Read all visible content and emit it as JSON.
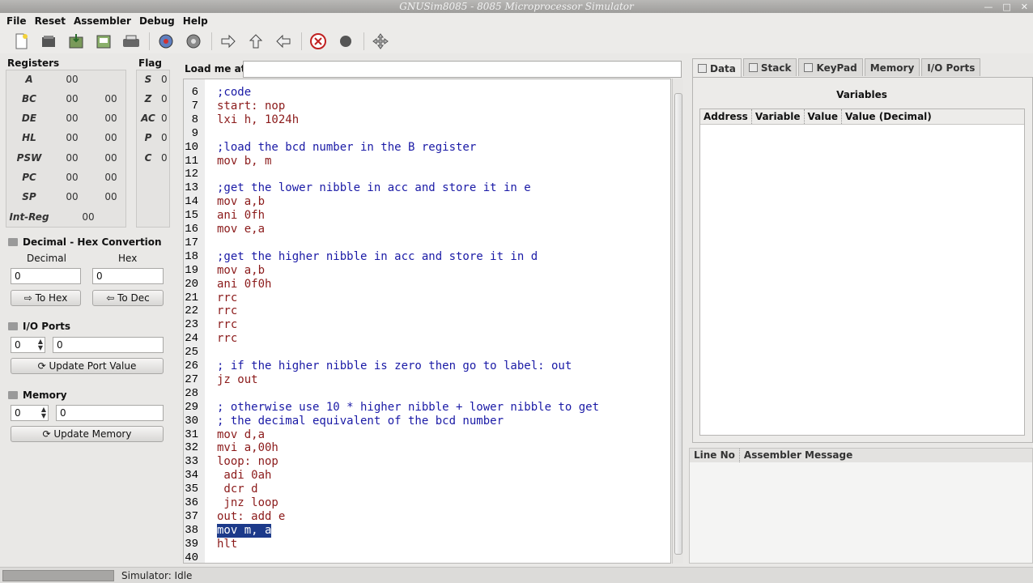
{
  "window": {
    "title": "GNUSim8085 - 8085 Microprocessor Simulator"
  },
  "menu": [
    "File",
    "Reset",
    "Assembler",
    "Debug",
    "Help"
  ],
  "toolbar": [
    "new-file-icon",
    "open-icon",
    "save-icon",
    "save-as-icon",
    "print-icon",
    "assemble-icon",
    "execute-icon",
    "step-in-icon",
    "step-over-icon",
    "step-out-icon",
    "stop-icon",
    "breakpoint-icon",
    "tools-icon"
  ],
  "registers": {
    "title": "Registers",
    "rows": [
      {
        "name": "A",
        "v1": "00",
        "v2": ""
      },
      {
        "name": "BC",
        "v1": "00",
        "v2": "00"
      },
      {
        "name": "DE",
        "v1": "00",
        "v2": "00"
      },
      {
        "name": "HL",
        "v1": "00",
        "v2": "00"
      },
      {
        "name": "PSW",
        "v1": "00",
        "v2": "00"
      },
      {
        "name": "PC",
        "v1": "00",
        "v2": "00"
      },
      {
        "name": "SP",
        "v1": "00",
        "v2": "00"
      },
      {
        "name": "Int-Reg",
        "v1": "00",
        "v2": ""
      }
    ]
  },
  "flags": {
    "title": "Flag",
    "rows": [
      {
        "name": "S",
        "value": "0"
      },
      {
        "name": "Z",
        "value": "0"
      },
      {
        "name": "AC",
        "value": "0"
      },
      {
        "name": "P",
        "value": "0"
      },
      {
        "name": "C",
        "value": "0"
      }
    ]
  },
  "converter": {
    "title": "Decimal - Hex Convertion",
    "decimal_label": "Decimal",
    "hex_label": "Hex",
    "decimal_value": "0",
    "hex_value": "0",
    "to_hex": "To Hex",
    "to_dec": "To Dec"
  },
  "io_ports": {
    "title": "I/O Ports",
    "port": "0",
    "value": "0",
    "button": "Update Port Value"
  },
  "memory": {
    "title": "Memory",
    "address": "0",
    "value": "0",
    "button": "Update Memory"
  },
  "load": {
    "label": "Load me at",
    "value": ""
  },
  "editor": {
    "lines": [
      {
        "n": "6",
        "text": ";code",
        "color": "#1a1aa6"
      },
      {
        "n": "7",
        "text": "start: nop",
        "color": "#8b1a1a"
      },
      {
        "n": "8",
        "text": "lxi h, 1024h",
        "color": "#8b1a1a"
      },
      {
        "n": "9",
        "text": "",
        "color": "#000"
      },
      {
        "n": "10",
        "text": ";load the bcd number in the B register",
        "color": "#1a1aa6"
      },
      {
        "n": "11",
        "text": "mov b, m",
        "color": "#8b1a1a"
      },
      {
        "n": "12",
        "text": "",
        "color": "#000"
      },
      {
        "n": "13",
        "text": ";get the lower nibble in acc and store it in e",
        "color": "#1a1aa6"
      },
      {
        "n": "14",
        "text": "mov a,b",
        "color": "#8b1a1a"
      },
      {
        "n": "15",
        "text": "ani 0fh",
        "color": "#8b1a1a"
      },
      {
        "n": "16",
        "text": "mov e,a",
        "color": "#8b1a1a"
      },
      {
        "n": "17",
        "text": "",
        "color": "#000"
      },
      {
        "n": "18",
        "text": ";get the higher nibble in acc and store it in d",
        "color": "#1a1aa6"
      },
      {
        "n": "19",
        "text": "mov a,b",
        "color": "#8b1a1a"
      },
      {
        "n": "20",
        "text": "ani 0f0h",
        "color": "#8b1a1a"
      },
      {
        "n": "21",
        "text": "rrc",
        "color": "#8b1a1a"
      },
      {
        "n": "22",
        "text": "rrc",
        "color": "#8b1a1a"
      },
      {
        "n": "23",
        "text": "rrc",
        "color": "#8b1a1a"
      },
      {
        "n": "24",
        "text": "rrc",
        "color": "#8b1a1a"
      },
      {
        "n": "25",
        "text": "",
        "color": "#000"
      },
      {
        "n": "26",
        "text": "; if the higher nibble is zero then go to label: out",
        "color": "#1a1aa6"
      },
      {
        "n": "27",
        "text": "jz out",
        "color": "#8b1a1a"
      },
      {
        "n": "28",
        "text": "",
        "color": "#000"
      },
      {
        "n": "29",
        "text": "; otherwise use 10 * higher nibble + lower nibble to get",
        "color": "#1a1aa6"
      },
      {
        "n": "30",
        "text": "; the decimal equivalent of the bcd number",
        "color": "#1a1aa6"
      },
      {
        "n": "31",
        "text": "mov d,a",
        "color": "#8b1a1a"
      },
      {
        "n": "32",
        "text": "mvi a,00h",
        "color": "#8b1a1a"
      },
      {
        "n": "33",
        "text": "loop: nop",
        "color": "#8b1a1a"
      },
      {
        "n": "34",
        "text": " adi 0ah",
        "color": "#8b1a1a"
      },
      {
        "n": "35",
        "text": " dcr d",
        "color": "#8b1a1a"
      },
      {
        "n": "36",
        "text": " jnz loop",
        "color": "#8b1a1a"
      },
      {
        "n": "37",
        "text": "out: add e",
        "color": "#8b1a1a"
      },
      {
        "n": "38",
        "text": "mov m, a",
        "color": "#ffffff",
        "selected": true
      },
      {
        "n": "39",
        "text": "hlt",
        "color": "#8b1a1a"
      },
      {
        "n": "40",
        "text": "",
        "color": "#000"
      }
    ]
  },
  "tabs": [
    "Data",
    "Stack",
    "KeyPad",
    "Memory",
    "I/O Ports"
  ],
  "variables": {
    "title": "Variables",
    "columns": [
      "Address",
      "Variable",
      "Value",
      "Value (Decimal)"
    ]
  },
  "messages": {
    "columns": [
      "Line No",
      "Assembler Message"
    ]
  },
  "status": {
    "text": "Simulator: Idle"
  }
}
